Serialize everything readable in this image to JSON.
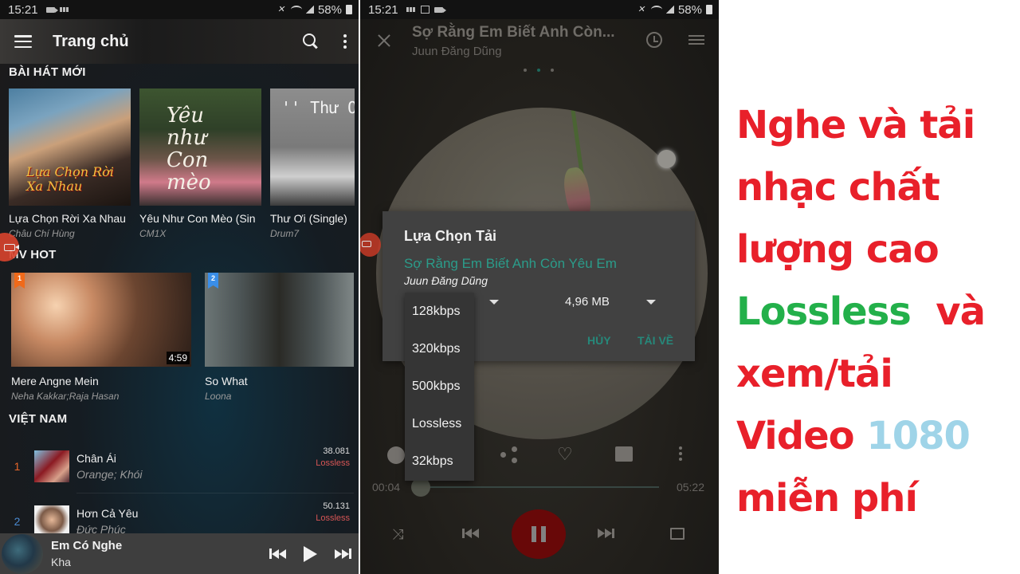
{
  "home": {
    "status": {
      "time": "15:21",
      "battery": "58%"
    },
    "appbar": {
      "title": "Trang chủ"
    },
    "sections": {
      "new_songs": "BÀI HÁT MỚI",
      "mv_hot": "MV HOT",
      "vietnam": "VIỆT NAM"
    },
    "new_songs": [
      {
        "title": "Lựa Chọn Rời Xa Nhau",
        "artist": "Châu Chí Hùng",
        "art_text": "Lựa Chọn Rời Xa Nhau"
      },
      {
        "title": "Yêu Như Con Mèo (Sin",
        "artist": "CM1X",
        "art_text": "Yêu như Con mèo"
      },
      {
        "title": "Thư Ơi (Single)",
        "artist": "Drum7",
        "art_text": "'' Thư Ơ"
      }
    ],
    "mv_hot": [
      {
        "rank": "1",
        "title": "Mere Angne Mein",
        "artist": "Neha Kakkar;Raja Hasan",
        "duration": "4:59",
        "flag_color": "#f06a1a"
      },
      {
        "rank": "2",
        "title": "So What",
        "artist": "Loona",
        "flag_color": "#3a8ee8"
      }
    ],
    "chart": [
      {
        "rank": "1",
        "song": "Chân Ái",
        "artist": "Orange; Khói",
        "plays": "38.081",
        "quality": "Lossless",
        "rank_color": "#e8662a"
      },
      {
        "rank": "2",
        "song": "Hơn Cả Yêu",
        "artist": "Đức Phúc",
        "plays": "50.131",
        "quality": "Lossless",
        "rank_color": "#4a8ad0"
      }
    ],
    "mini_player": {
      "song": "Em Có Nghe",
      "artist": "Kha"
    }
  },
  "player": {
    "status": {
      "time": "15:21",
      "battery": "58%"
    },
    "header": {
      "title": "Sợ Rằng Em Biết Anh Còn...",
      "artist": "Juun Đăng Dũng"
    },
    "pager": {
      "count": 3,
      "active": 2
    },
    "dialog": {
      "title": "Lựa Chọn Tải",
      "song": "Sợ Rằng Em Biết Anh Còn Yêu Em",
      "artist": "Juun Đăng Dũng",
      "size": "4,96 MB",
      "cancel": "HỦY",
      "download": "TẢI VỀ"
    },
    "quality_options": [
      "128kbps",
      "320kbps",
      "500kbps",
      "Lossless",
      "32kbps"
    ],
    "progress": {
      "current": "00:04",
      "duration": "05:22",
      "fraction": 0.013
    }
  },
  "promo": {
    "line1": "Nghe và tải",
    "line2": "nhạc chất",
    "line3": "lượng cao",
    "line4_green": "Lossless",
    "line4_rest": "  và",
    "line5": "xem/tải",
    "line6_red": "Video ",
    "line6_blue": "1080",
    "line7": "miễn phí"
  }
}
